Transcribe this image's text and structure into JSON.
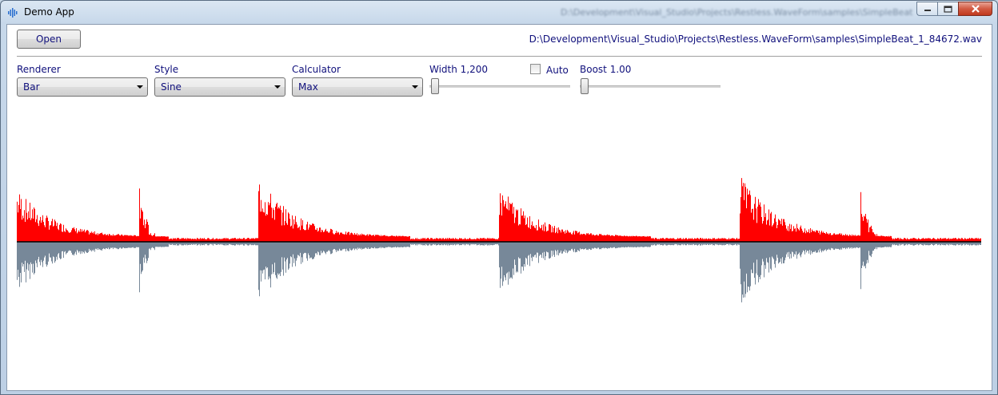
{
  "window": {
    "title": "Demo App",
    "blurred_path_text": "D:\\Development\\Visual_Studio\\Projects\\Restless.WaveForm\\samples\\SimpleBeat",
    "icon": "audio-waveform-icon",
    "caption_icons": [
      "minimize-icon",
      "maximize-icon",
      "close-icon"
    ]
  },
  "toolbar": {
    "open_label": "Open",
    "file_path": "D:\\Development\\Visual_Studio\\Projects\\Restless.WaveForm\\samples\\SimpleBeat_1_84672.wav"
  },
  "controls": {
    "renderer": {
      "label": "Renderer",
      "value": "Bar"
    },
    "style": {
      "label": "Style",
      "value": "Sine"
    },
    "calculator": {
      "label": "Calculator",
      "value": "Max"
    },
    "width": {
      "label": "Width 1,200",
      "level": 0
    },
    "auto": {
      "label": "Auto",
      "checked": false
    },
    "boost": {
      "label": "Boost 1.00",
      "level": 0
    }
  },
  "waveform": {
    "top_color": "#ff0000",
    "bottom_color": "#778899",
    "center_line_color": "#000000",
    "sample_file": "SimpleBeat_1_84672.wav"
  }
}
